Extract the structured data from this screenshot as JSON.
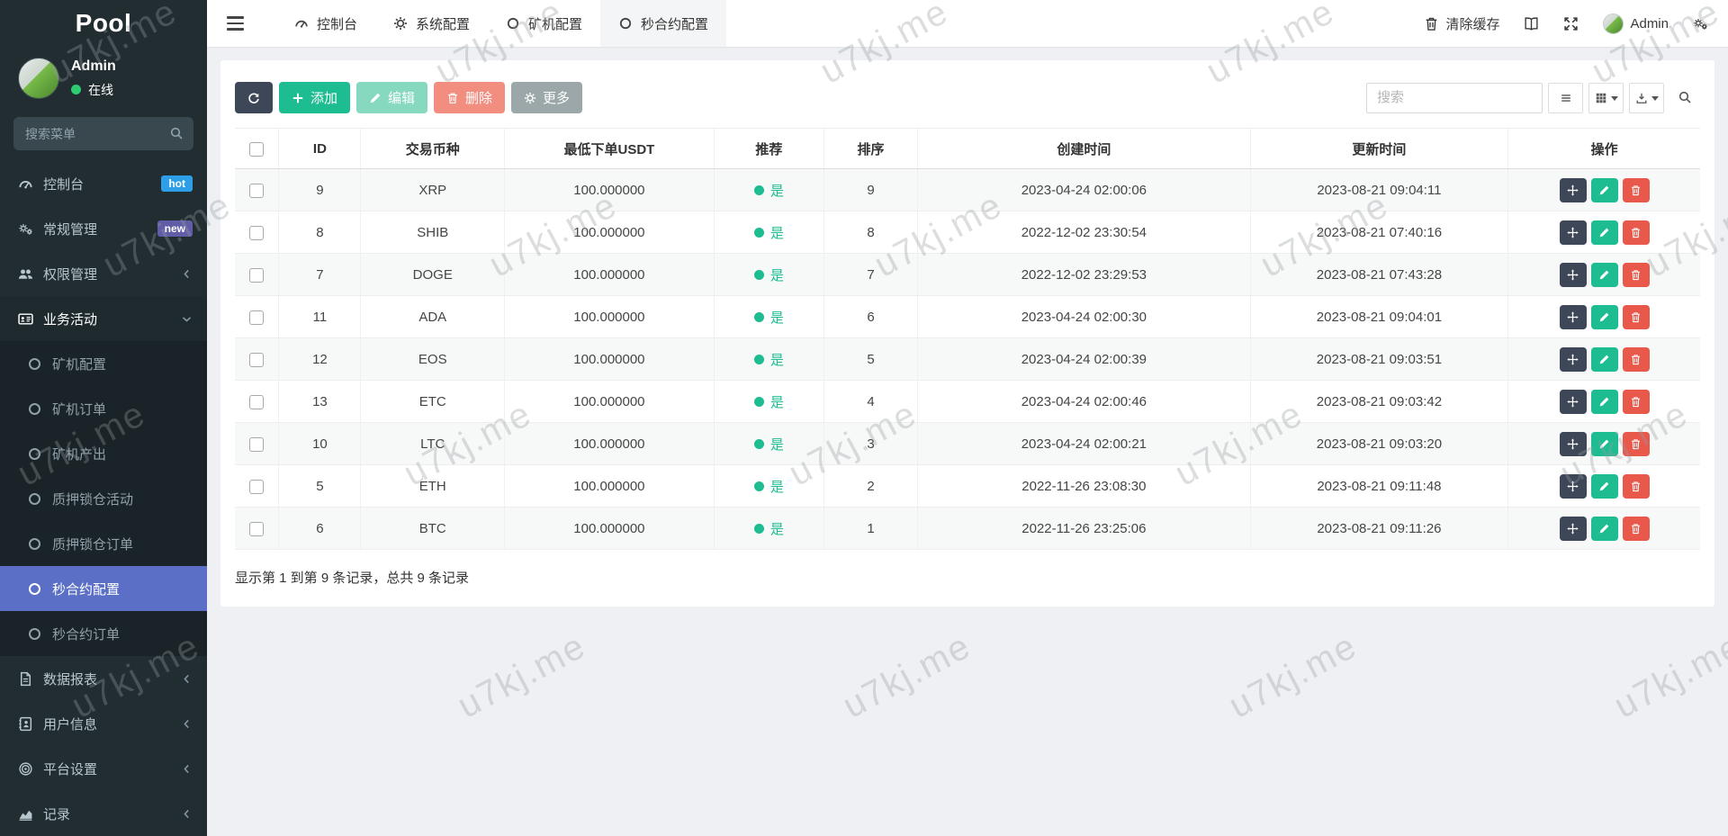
{
  "watermark": {
    "text": "u7kj.me"
  },
  "colors": {
    "primary_green": "#1dbc91",
    "active_menu": "#5a6fc5",
    "online_dot": "#2ecc71",
    "hot_badge": "#2d9fe8",
    "new_badge": "#605ca8",
    "danger": "#e8594c",
    "dark_button": "#3e4757"
  },
  "sidebar": {
    "logo": "Pool",
    "user": {
      "name": "Admin",
      "status_label": "在线"
    },
    "search_placeholder": "搜索菜单",
    "menu": [
      {
        "id": "dashboard",
        "label": "控制台",
        "icon": "dashboard",
        "badge": {
          "text": "hot",
          "color": "#2d9fe8"
        }
      },
      {
        "id": "general-manage",
        "label": "常规管理",
        "icon": "cogs",
        "badge": {
          "text": "new",
          "color": "#605ca8"
        }
      },
      {
        "id": "permission-manage",
        "label": "权限管理",
        "icon": "users",
        "chevron": "left"
      },
      {
        "id": "business-activity",
        "label": "业务活动",
        "icon": "idcard",
        "chevron": "down",
        "expanded": true,
        "children": [
          {
            "id": "miner-config",
            "label": "矿机配置"
          },
          {
            "id": "miner-orders",
            "label": "矿机订单"
          },
          {
            "id": "miner-output",
            "label": "矿机产出"
          },
          {
            "id": "staking-activity",
            "label": "质押锁仓活动"
          },
          {
            "id": "staking-orders",
            "label": "质押锁仓订单"
          },
          {
            "id": "seconds-contract-config",
            "label": "秒合约配置",
            "active": true
          },
          {
            "id": "seconds-contract-orders",
            "label": "秒合约订单"
          }
        ]
      },
      {
        "id": "data-report",
        "label": "数据报表",
        "icon": "file",
        "chevron": "left"
      },
      {
        "id": "user-info",
        "label": "用户信息",
        "icon": "addressbook",
        "chevron": "left"
      },
      {
        "id": "platform-settings",
        "label": "平台设置",
        "icon": "bullseye",
        "chevron": "left"
      },
      {
        "id": "records",
        "label": "记录",
        "icon": "chart",
        "chevron": "left"
      }
    ]
  },
  "topbar": {
    "tabs": [
      {
        "id": "dashboard",
        "label": "控制台",
        "icon": "dashboard"
      },
      {
        "id": "system-config",
        "label": "系统配置",
        "icon": "gear"
      },
      {
        "id": "miner-config",
        "label": "矿机配置",
        "icon": "circle"
      },
      {
        "id": "seconds-contract-config",
        "label": "秒合约配置",
        "icon": "circle",
        "active": true
      }
    ],
    "actions": {
      "clear_cache_label": "清除缓存",
      "username": "Admin"
    }
  },
  "toolbar": {
    "buttons": [
      {
        "id": "refresh",
        "icon": "refresh",
        "label": "",
        "bg": "#3e4757"
      },
      {
        "id": "add",
        "icon": "plus",
        "label": "添加",
        "bg": "#1dbc91"
      },
      {
        "id": "edit",
        "icon": "pencil",
        "label": "编辑",
        "bg": "#86d8bf"
      },
      {
        "id": "delete",
        "icon": "trash",
        "label": "删除",
        "bg": "#f28e80"
      },
      {
        "id": "more",
        "icon": "gear",
        "label": "更多",
        "bg": "#9ba7a8"
      }
    ],
    "search_placeholder": "搜索",
    "view_buttons": [
      {
        "id": "toggle-view",
        "icon": "list"
      },
      {
        "id": "columns",
        "icon": "grid",
        "caret": true
      },
      {
        "id": "export",
        "icon": "export",
        "caret": true
      },
      {
        "id": "search",
        "icon": "search",
        "plain": true
      }
    ]
  },
  "table": {
    "columns": [
      {
        "key": "checkbox",
        "label": "",
        "width": "3%"
      },
      {
        "key": "id",
        "label": "ID",
        "width": "5.6%"
      },
      {
        "key": "coin",
        "label": "交易币种",
        "width": "9.8%"
      },
      {
        "key": "min_order",
        "label": "最低下单USDT",
        "width": "14.3%"
      },
      {
        "key": "recommend",
        "label": "推荐",
        "width": "7.5%"
      },
      {
        "key": "sort",
        "label": "排序",
        "width": "6.4%"
      },
      {
        "key": "created_at",
        "label": "创建时间",
        "width": "22.7%"
      },
      {
        "key": "updated_at",
        "label": "更新时间",
        "width": "17.6%"
      },
      {
        "key": "ops",
        "label": "操作",
        "width": "13.1%"
      }
    ],
    "rows": [
      {
        "id": "9",
        "coin": "XRP",
        "min_order": "100.000000",
        "recommend": "是",
        "sort": "9",
        "created_at": "2023-04-24 02:00:06",
        "updated_at": "2023-08-21 09:04:11"
      },
      {
        "id": "8",
        "coin": "SHIB",
        "min_order": "100.000000",
        "recommend": "是",
        "sort": "8",
        "created_at": "2022-12-02 23:30:54",
        "updated_at": "2023-08-21 07:40:16"
      },
      {
        "id": "7",
        "coin": "DOGE",
        "min_order": "100.000000",
        "recommend": "是",
        "sort": "7",
        "created_at": "2022-12-02 23:29:53",
        "updated_at": "2023-08-21 07:43:28"
      },
      {
        "id": "11",
        "coin": "ADA",
        "min_order": "100.000000",
        "recommend": "是",
        "sort": "6",
        "created_at": "2023-04-24 02:00:30",
        "updated_at": "2023-08-21 09:04:01"
      },
      {
        "id": "12",
        "coin": "EOS",
        "min_order": "100.000000",
        "recommend": "是",
        "sort": "5",
        "created_at": "2023-04-24 02:00:39",
        "updated_at": "2023-08-21 09:03:51"
      },
      {
        "id": "13",
        "coin": "ETC",
        "min_order": "100.000000",
        "recommend": "是",
        "sort": "4",
        "created_at": "2023-04-24 02:00:46",
        "updated_at": "2023-08-21 09:03:42"
      },
      {
        "id": "10",
        "coin": "LTC",
        "min_order": "100.000000",
        "recommend": "是",
        "sort": "3",
        "created_at": "2023-04-24 02:00:21",
        "updated_at": "2023-08-21 09:03:20"
      },
      {
        "id": "5",
        "coin": "ETH",
        "min_order": "100.000000",
        "recommend": "是",
        "sort": "2",
        "created_at": "2022-11-26 23:08:30",
        "updated_at": "2023-08-21 09:11:48"
      },
      {
        "id": "6",
        "coin": "BTC",
        "min_order": "100.000000",
        "recommend": "是",
        "sort": "1",
        "created_at": "2022-11-26 23:25:06",
        "updated_at": "2023-08-21 09:11:26"
      }
    ],
    "ops": [
      {
        "id": "move",
        "icon": "move",
        "bg": "#3e4757"
      },
      {
        "id": "edit",
        "icon": "pencil",
        "bg": "#1dbc91"
      },
      {
        "id": "delete",
        "icon": "trash",
        "bg": "#e8594c"
      }
    ],
    "footer": "显示第 1 到第 9 条记录，总共 9 条记录"
  }
}
